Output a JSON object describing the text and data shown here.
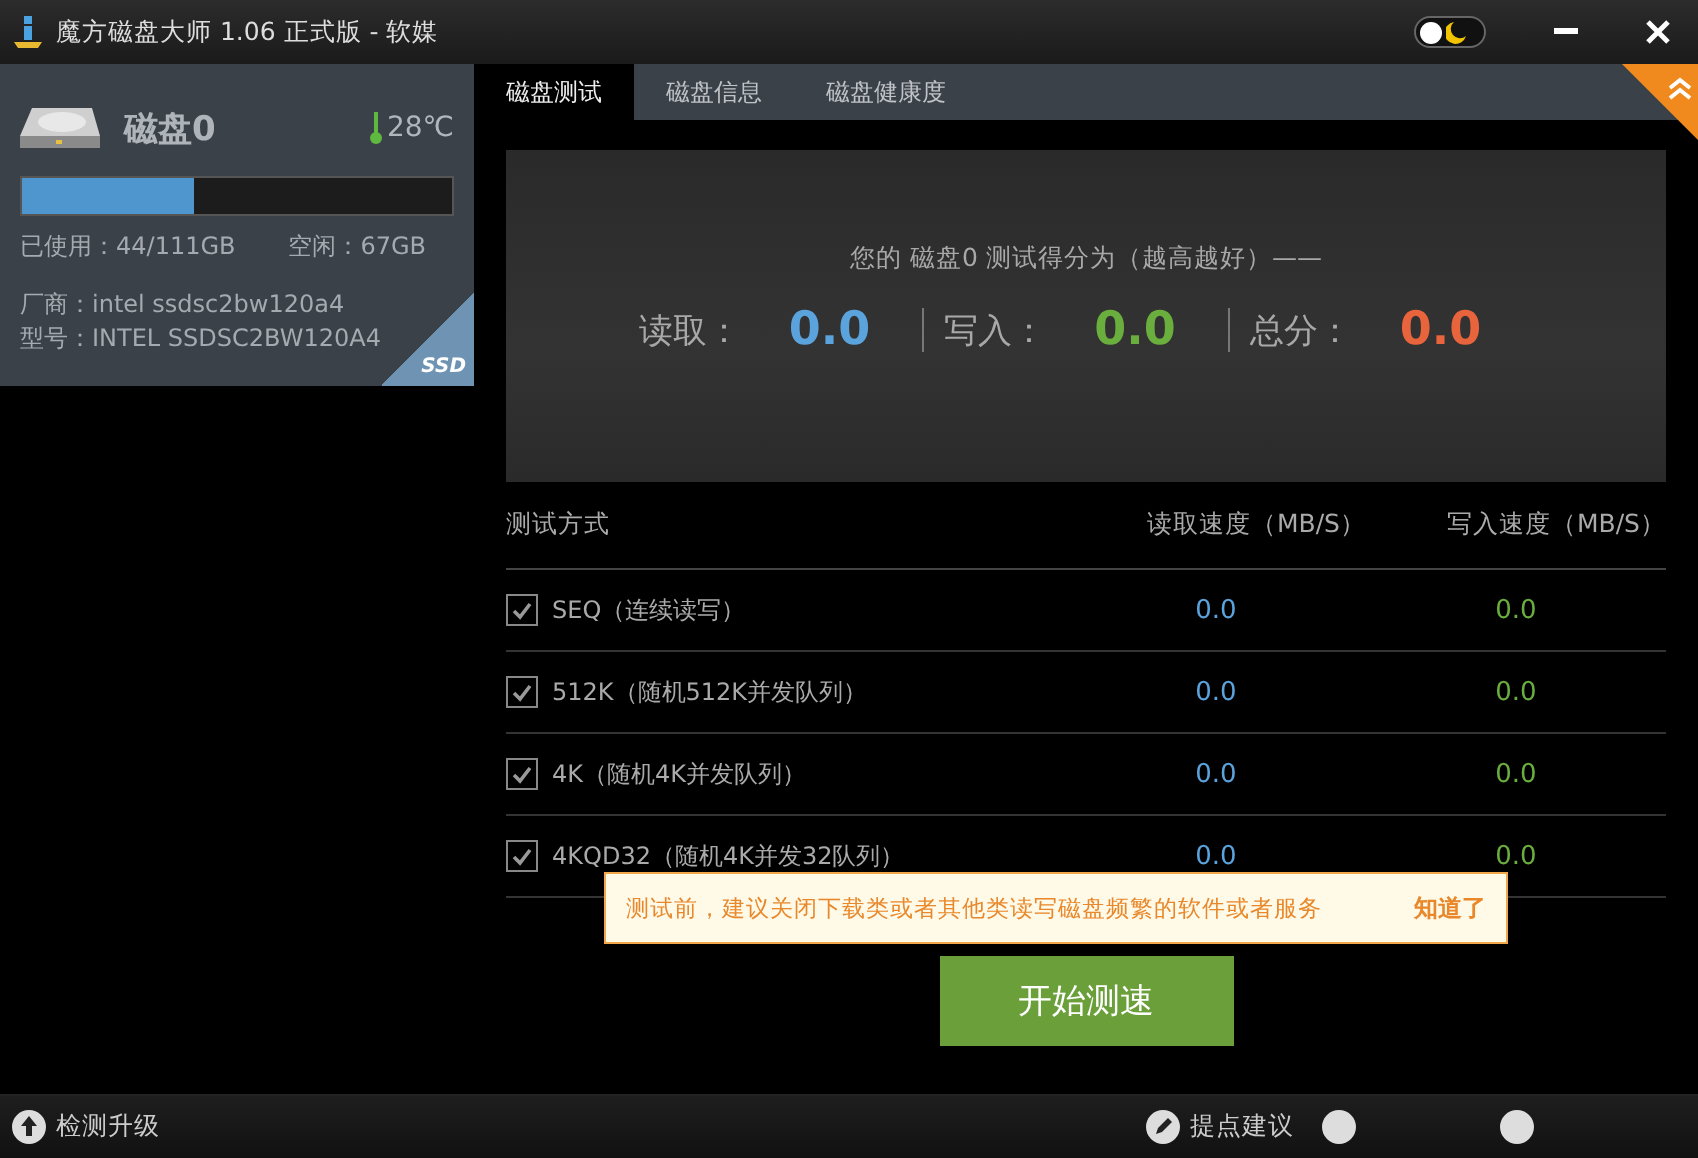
{
  "window": {
    "title": "魔方磁盘大师 1.06 正式版 - 软媒",
    "night_mode": false
  },
  "disk": {
    "name": "磁盘0",
    "temperature": "28℃",
    "level": 0.4,
    "used": "已使用：44/111GB",
    "free": "空闲：67GB",
    "vendor": "厂商：intel ssdsc2bw120a4",
    "model": "型号：INTEL SSDSC2BW120A4",
    "badge": "SSD"
  },
  "tabs": [
    {
      "label": "磁盘测试",
      "selected": true
    },
    {
      "label": "磁盘信息",
      "selected": false
    },
    {
      "label": "磁盘健康度",
      "selected": false
    }
  ],
  "score": {
    "caption": "您的 磁盘0 测试得分为（越高越好）——",
    "items": [
      {
        "label": "读取：",
        "value": "0.0",
        "color": "#5ba3dc"
      },
      {
        "label": "写入：",
        "value": "0.0",
        "color": "#6aae3e"
      },
      {
        "label": "总分：",
        "value": "0.0",
        "color": "#e8643c"
      }
    ]
  },
  "table": {
    "columns": [
      "测试方式",
      "读取速度（MB/S）",
      "写入速度（MB/S）"
    ],
    "rows": [
      {
        "name": "SEQ（连续读写）",
        "checked": true,
        "read": "0.0",
        "write": "0.0"
      },
      {
        "name": "512K（随机512K并发队列）",
        "checked": true,
        "read": "0.0",
        "write": "0.0"
      },
      {
        "name": "4K（随机4K并发队列）",
        "checked": true,
        "read": "0.0",
        "write": "0.0"
      },
      {
        "name": "4KQD32（随机4K并发32队列）",
        "checked": true,
        "read": "0.0",
        "write": "0.0"
      }
    ]
  },
  "tip": {
    "text": "测试前，建议关闭下载类或者其他类读写磁盘频繁的软件或者服务",
    "action": "知道了"
  },
  "start_button": "开始测速",
  "status_bar": {
    "update": "检测升级",
    "feedback": "提点建议"
  }
}
